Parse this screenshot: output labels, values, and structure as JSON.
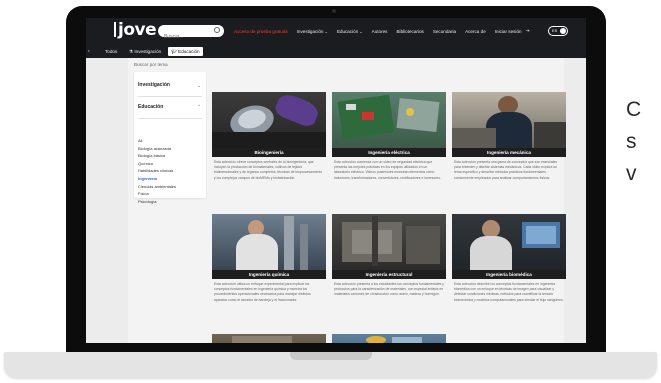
{
  "navbar": {
    "logo": "jove",
    "search_placeholder": "Buscar...",
    "items": [
      {
        "label": "Acceso de prueba gratuita",
        "promo": true,
        "chevron": false
      },
      {
        "label": "Investigación",
        "promo": false,
        "chevron": true
      },
      {
        "label": "Educación",
        "promo": false,
        "chevron": true
      },
      {
        "label": "Autores",
        "promo": false,
        "chevron": false
      },
      {
        "label": "Bibliotecarios",
        "promo": false,
        "chevron": false
      },
      {
        "label": "Secundaria",
        "promo": false,
        "chevron": false
      },
      {
        "label": "Acerca de",
        "promo": false,
        "chevron": false
      },
      {
        "label": "Iniciar sesión",
        "promo": false,
        "chevron": false
      }
    ],
    "lang": "ES"
  },
  "tabs": [
    {
      "label": "Todos"
    },
    {
      "label": "Investigación"
    },
    {
      "label": "Educación"
    }
  ],
  "breadcrumb": "Buscar por tema",
  "sidebar": {
    "section1": "Investigación",
    "section2": "Educación",
    "items": [
      "All",
      "Biología avanzada",
      "Biología básica",
      "Química",
      "Habilidades clínicas",
      "Ingeniería",
      "Ciencias ambientales",
      "Física",
      "Psicología"
    ],
    "selected_index": 5
  },
  "cards": [
    {
      "title": "Bioingeniería",
      "desc": "Esta colección ofrece conceptos centrales de la bioingeniería, que incluyen la producción de biomateriales, cultivos de tejidos tridimensionales y de órganos completos, técnicas de bioprocesamiento y los complejos campos de bioMEMs y biofabricación."
    },
    {
      "title": "Ingeniería eléctrica",
      "desc": "Esta colección comienza con un video de seguridad eléctrica que presenta las mejores prácticas en los equipos utilizados en un laboratorio eléctrico. Videos posteriores muestran elementos cómo inductores, transformadores, convertidores, rectificadores e inversores."
    },
    {
      "title": "Ingeniería mecánica",
      "desc": "Esta colección presenta una gama de conceptos que son esenciales para entender y diseñar sistemas mecánicos. Cada video explora un tema específico y describe métodos prácticos fundamentales comúnmente empleados para analizar comportamientos físicos."
    },
    {
      "title": "Ingeniería química",
      "desc": "Esta colección utiliza un enfoque experimental para explicar los conceptos fundamentales en ingeniería química y muestra los procedimientos operacionales necesarios para manejar distintos aparatos como el secador de bandeja y el fraccionador."
    },
    {
      "title": "Ingeniería estructural",
      "desc": "Esta colección presenta a los estudiantes los conceptos fundamentales y protocolos para la caracterización de materiales, con especial énfasis en materiales comunes de construcción como acero, madera y hormigón."
    },
    {
      "title": "Ingeniería biomédica",
      "desc": "Esta colección describe los conceptos fundamentales en ingeniería biomédica con un enfoque en técnicas de imagen para visualizar y detectar condiciones médicas, métodos para cuantificar la tensión biomecánica y modelos computacionales para simular el flujo sanguíneo."
    }
  ],
  "side_text": [
    "C",
    "s",
    "v"
  ]
}
